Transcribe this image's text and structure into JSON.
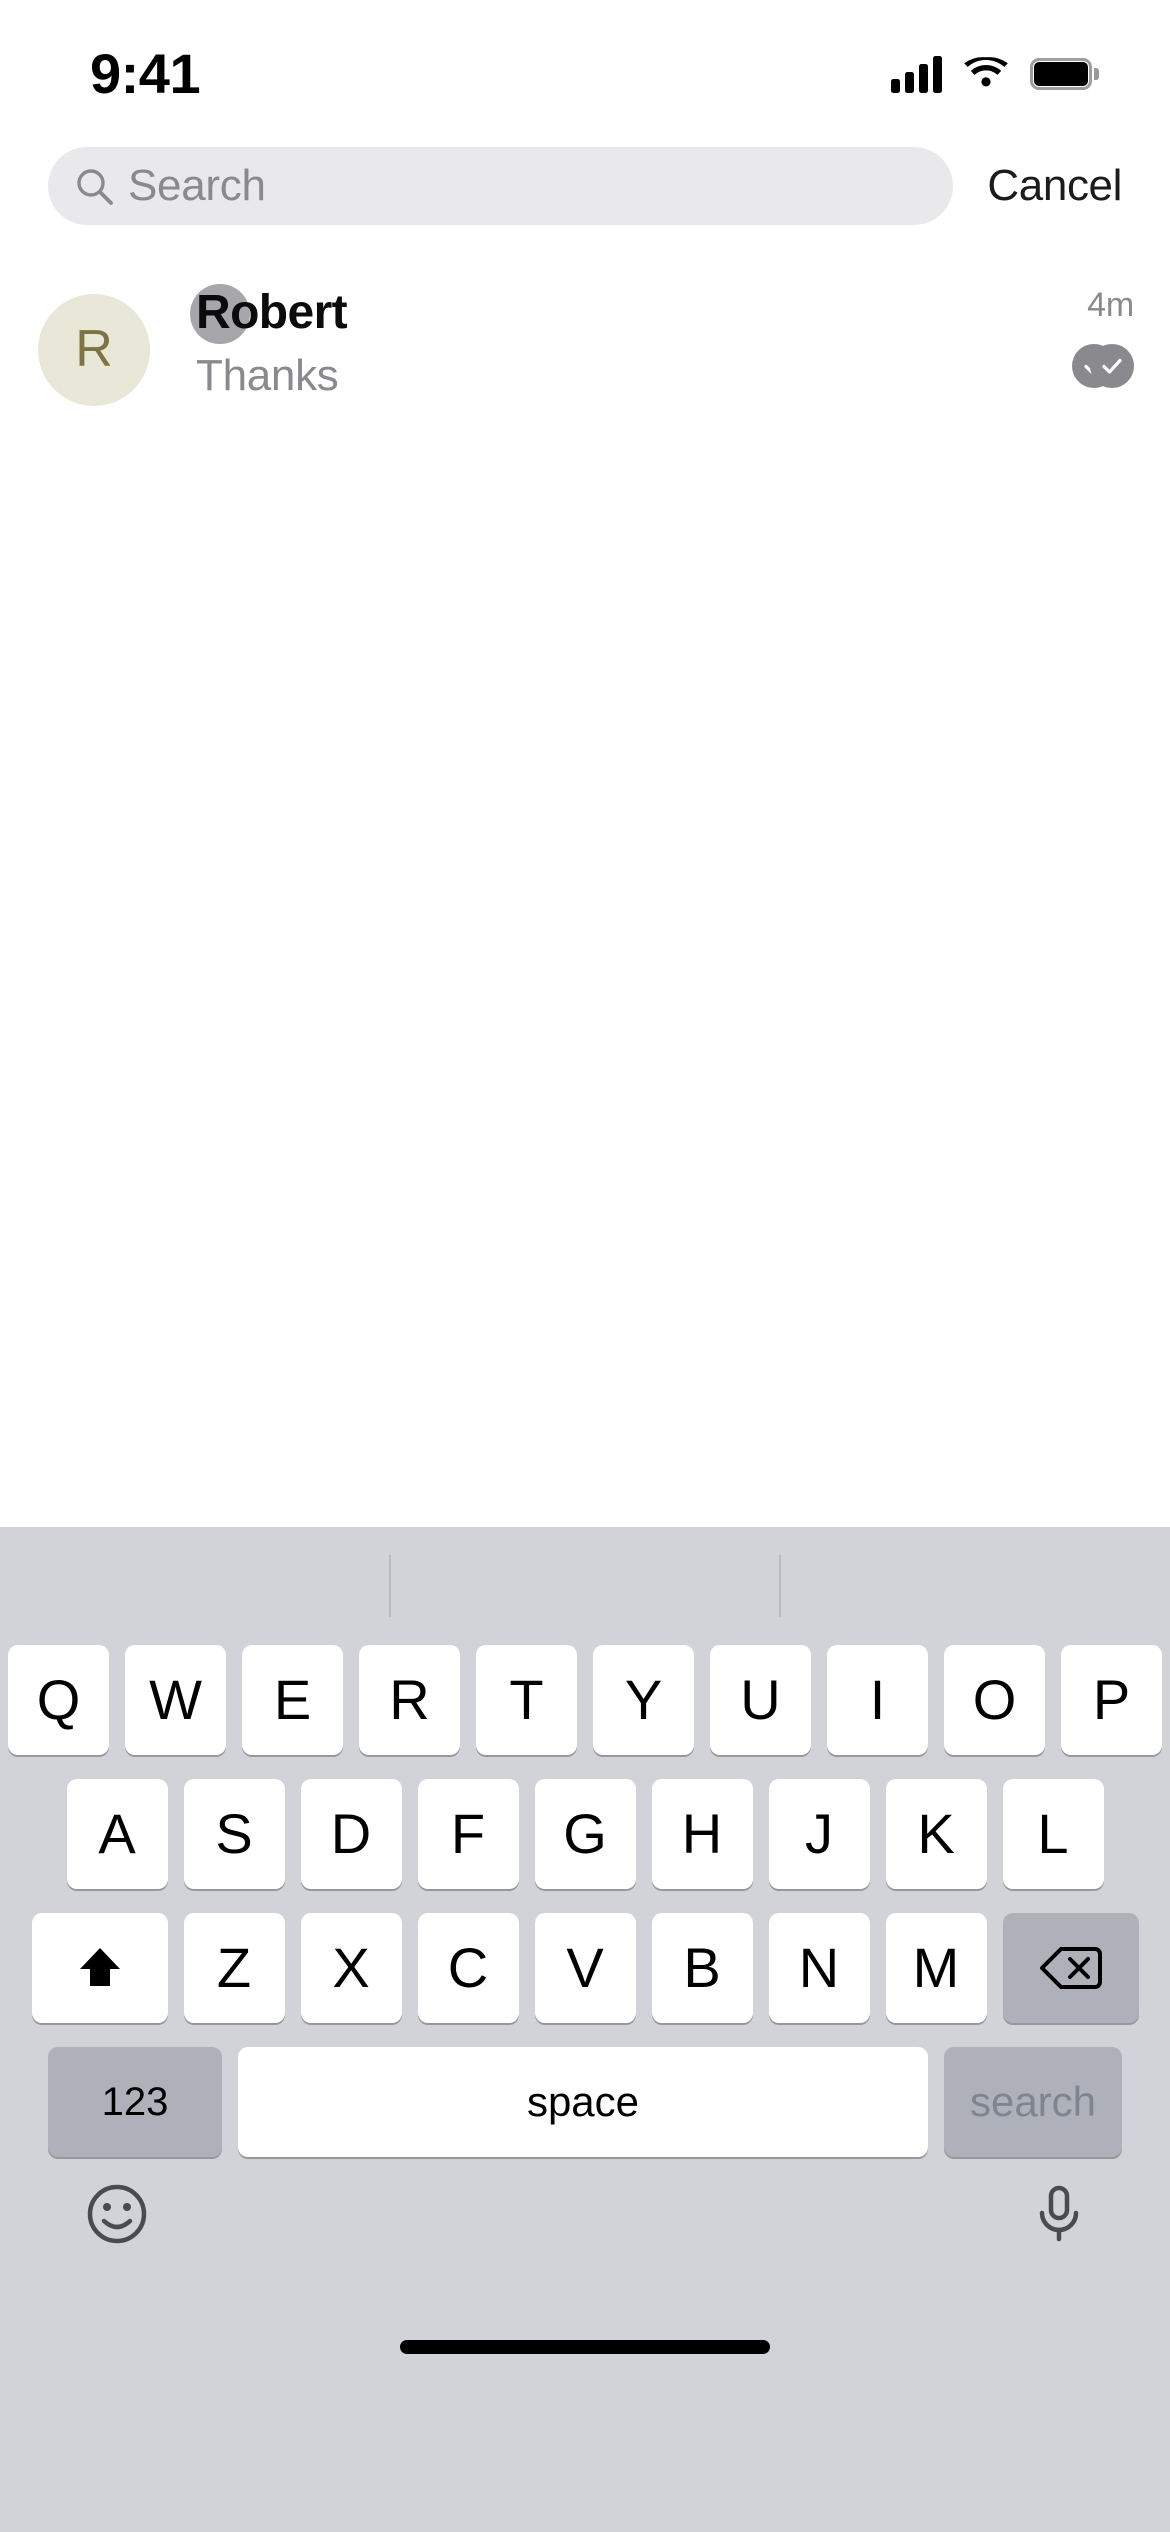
{
  "status_bar": {
    "time": "9:41",
    "cellular_icon": "signal-bars-icon",
    "wifi_icon": "wifi-icon",
    "battery_icon": "battery-full-icon"
  },
  "search": {
    "placeholder": "Search",
    "value": "",
    "icon": "search-icon",
    "cancel_label": "Cancel"
  },
  "results": [
    {
      "avatar_letter": "R",
      "avatar_bg": "#E9E7D8",
      "avatar_fg": "#7C7541",
      "name": "Robert",
      "preview": "Thanks",
      "time": "4m",
      "status_icon": "double-check-read-icon",
      "name_highlight_color": "#8E8E93"
    }
  ],
  "keyboard": {
    "row1": [
      "Q",
      "W",
      "E",
      "R",
      "T",
      "Y",
      "U",
      "I",
      "O",
      "P"
    ],
    "row2": [
      "A",
      "S",
      "D",
      "F",
      "G",
      "H",
      "J",
      "K",
      "L"
    ],
    "row3": [
      "Z",
      "X",
      "C",
      "V",
      "B",
      "N",
      "M"
    ],
    "shift_icon": "shift-arrow-icon",
    "backspace_icon": "backspace-delete-icon",
    "numbers_label": "123",
    "space_label": "space",
    "return_label": "search",
    "emoji_icon": "emoji-smiley-icon",
    "dictation_icon": "microphone-icon"
  },
  "home_indicator": "home-indicator"
}
